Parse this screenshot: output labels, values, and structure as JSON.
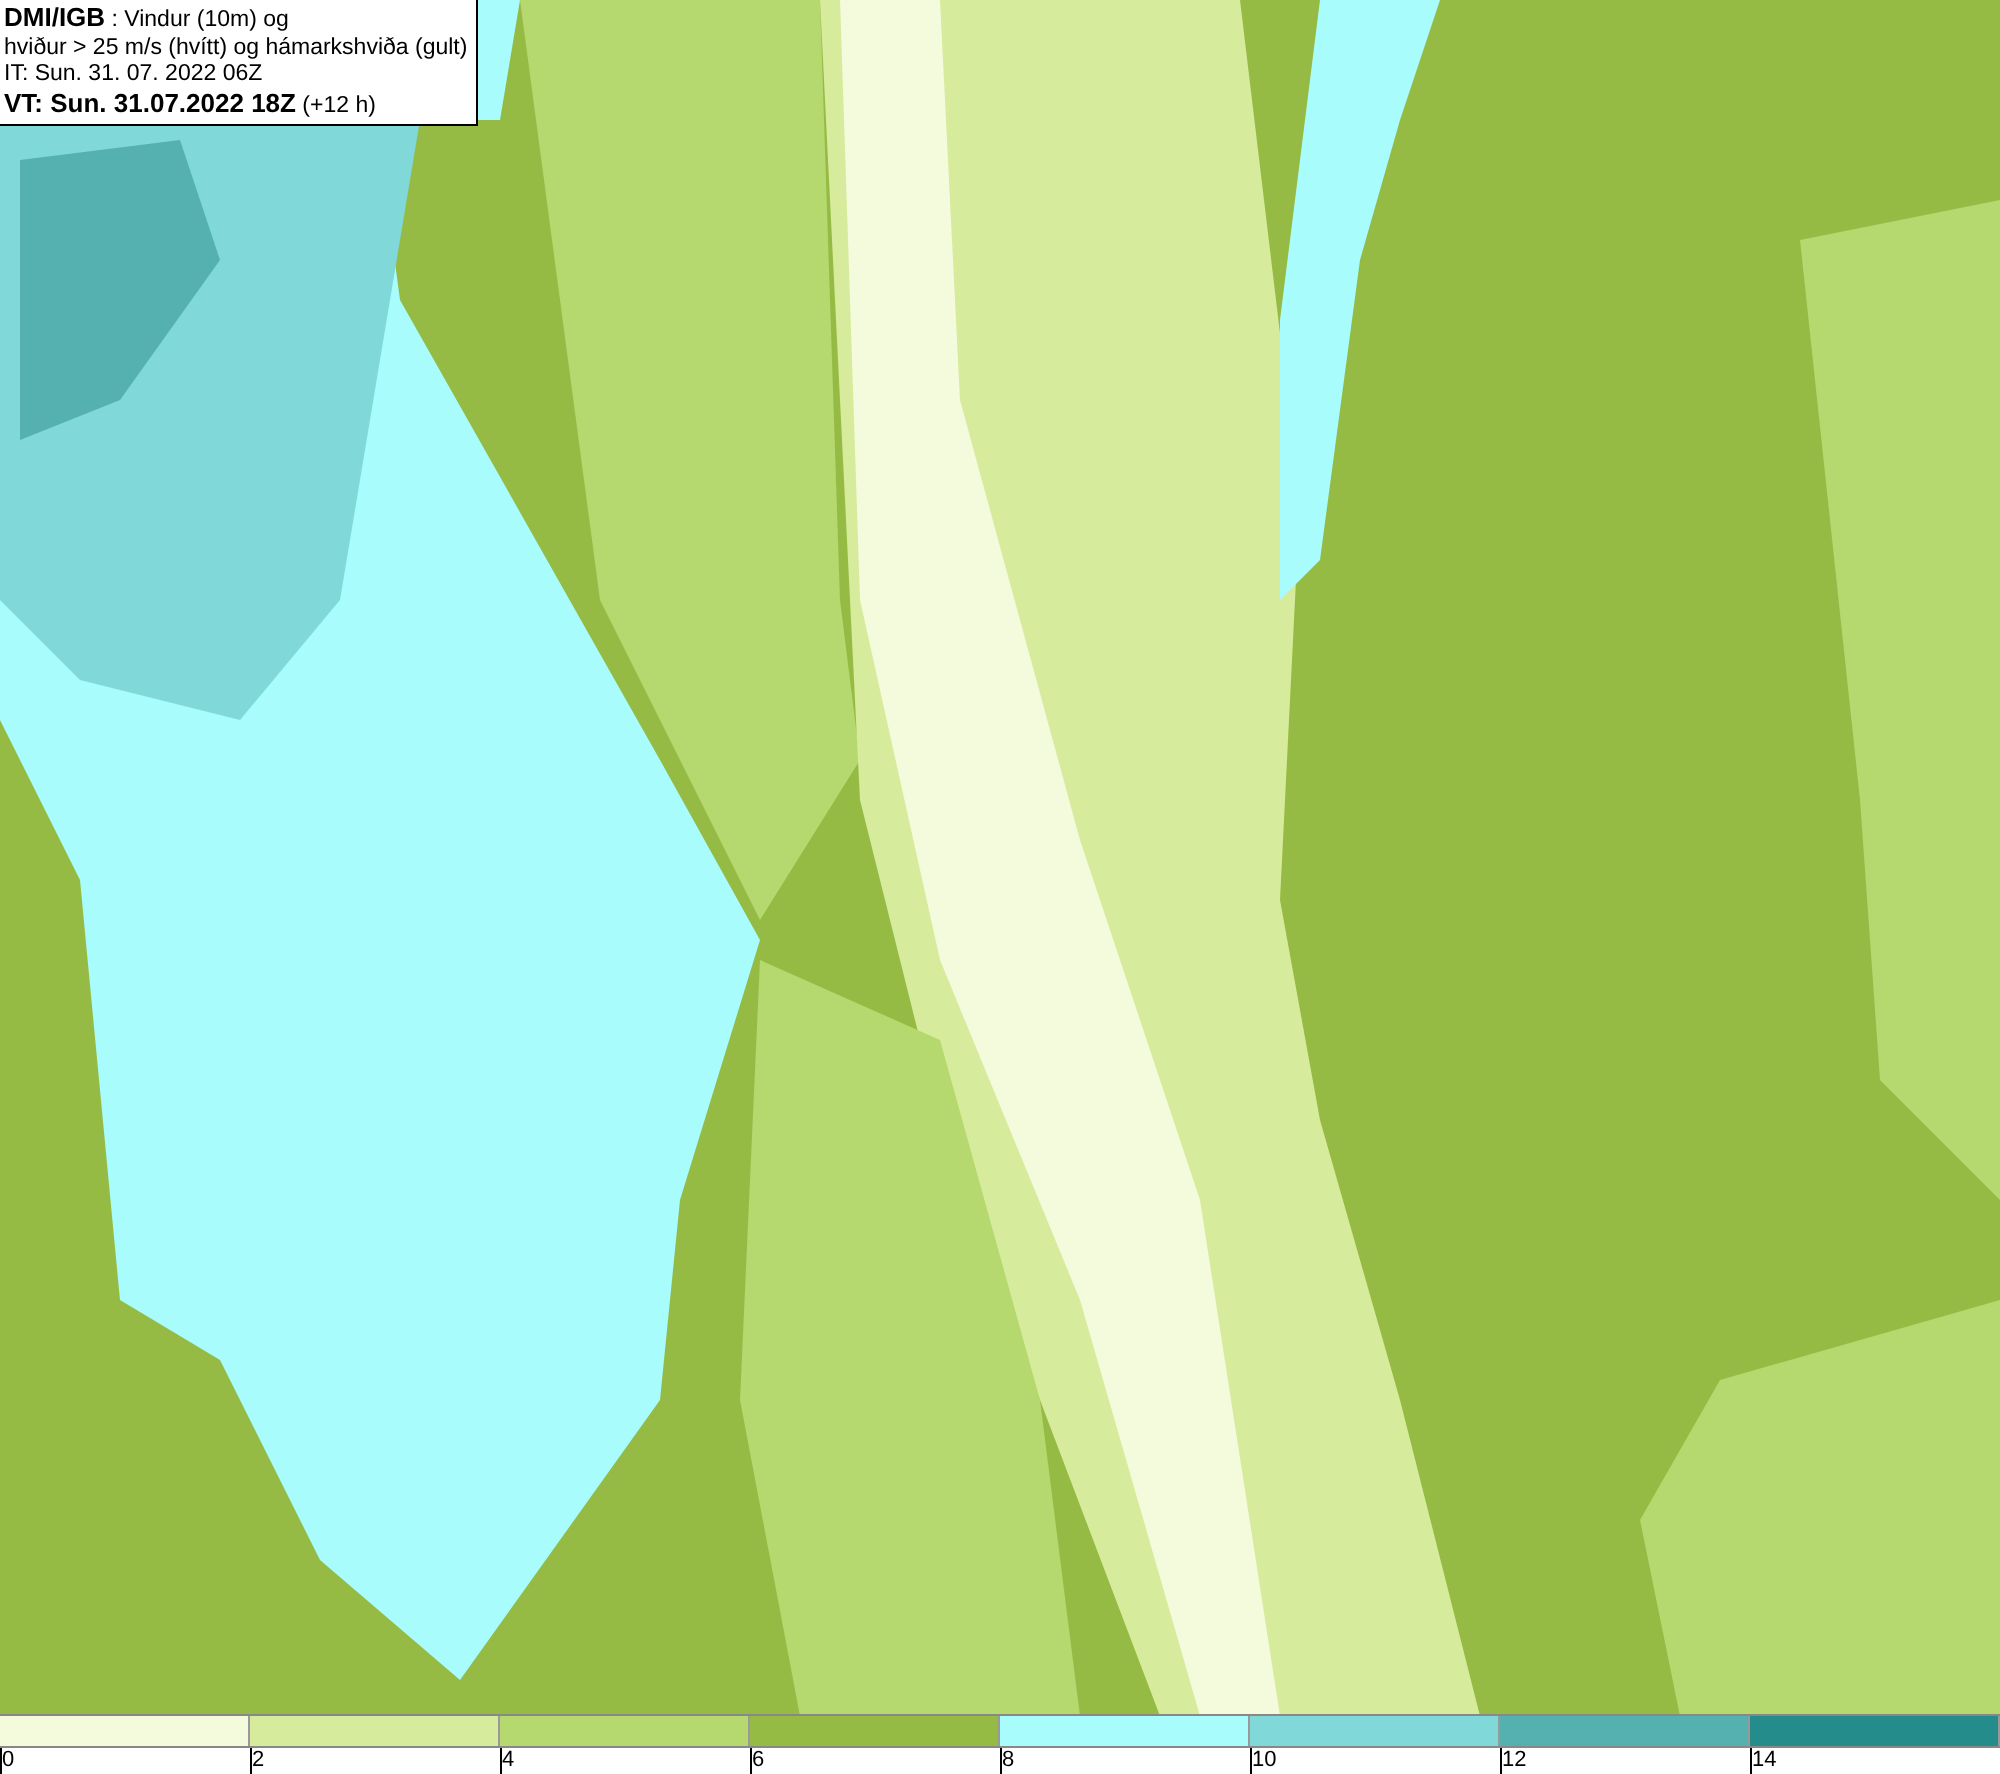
{
  "header": {
    "lines": [
      "**DMI/IGB** : Vindur (10m) og",
      "hviður > 25 m/s (hvítt) og hámarkshviða (gult)",
      "IT: Sun. 31. 07. 2022 06Z",
      "**VT: Sun. 31.07.2022 18Z** (+12 h)"
    ]
  },
  "legend": {
    "bins": [
      {
        "color": "#f4fadc"
      },
      {
        "color": "#d7eb9c"
      },
      {
        "color": "#b5d86f"
      },
      {
        "color": "#95bb44"
      },
      {
        "color": "#a8fcfc"
      },
      {
        "color": "#80d8d8"
      },
      {
        "color": "#55b0b0"
      },
      {
        "color": "#258c8c"
      }
    ],
    "ticks": [
      "0",
      "2",
      "4",
      "6",
      "8",
      "10",
      "12",
      "14"
    ]
  }
}
